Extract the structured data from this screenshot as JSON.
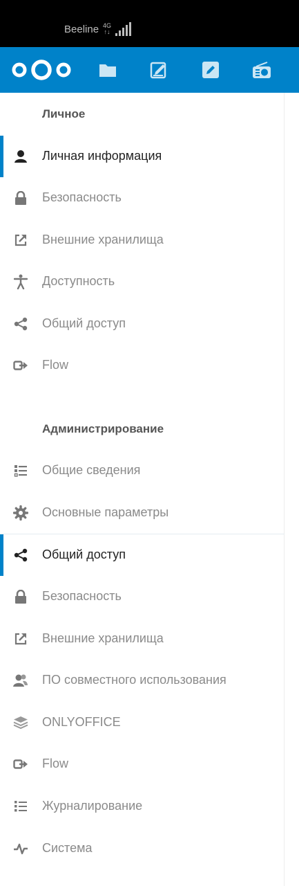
{
  "status_bar": {
    "carrier": "Beeline",
    "network_top": "4G",
    "network_bottom": "↑↓"
  },
  "top_bar": {
    "accent_color": "#0082c9",
    "logo": "nextcloud-logo",
    "apps": [
      "files-icon",
      "notes-icon",
      "edit-icon",
      "radio-icon"
    ]
  },
  "sidebar": {
    "personal": {
      "title": "Личное",
      "items": [
        {
          "label": "Личная информация",
          "icon": "user-icon",
          "active": true
        },
        {
          "label": "Безопасность",
          "icon": "lock-icon"
        },
        {
          "label": "Внешние хранилища",
          "icon": "external-link-icon"
        },
        {
          "label": "Доступность",
          "icon": "accessibility-icon"
        },
        {
          "label": "Общий доступ",
          "icon": "share-icon"
        },
        {
          "label": "Flow",
          "icon": "flow-icon"
        }
      ]
    },
    "admin": {
      "title": "Администрирование",
      "items": [
        {
          "label": "Общие сведения",
          "icon": "list-icon"
        },
        {
          "label": "Основные параметры",
          "icon": "gear-icon"
        },
        {
          "label": "Общий доступ",
          "icon": "share-icon",
          "active": true
        },
        {
          "label": "Безопасность",
          "icon": "lock-icon"
        },
        {
          "label": "Внешние хранилища",
          "icon": "external-link-icon"
        },
        {
          "label": "ПО совместного использования",
          "icon": "groupware-icon"
        },
        {
          "label": "ONLYOFFICE",
          "icon": "layers-icon"
        },
        {
          "label": "Flow",
          "icon": "flow-icon"
        },
        {
          "label": "Журналирование",
          "icon": "log-list-icon"
        },
        {
          "label": "Система",
          "icon": "activity-icon"
        }
      ]
    }
  }
}
